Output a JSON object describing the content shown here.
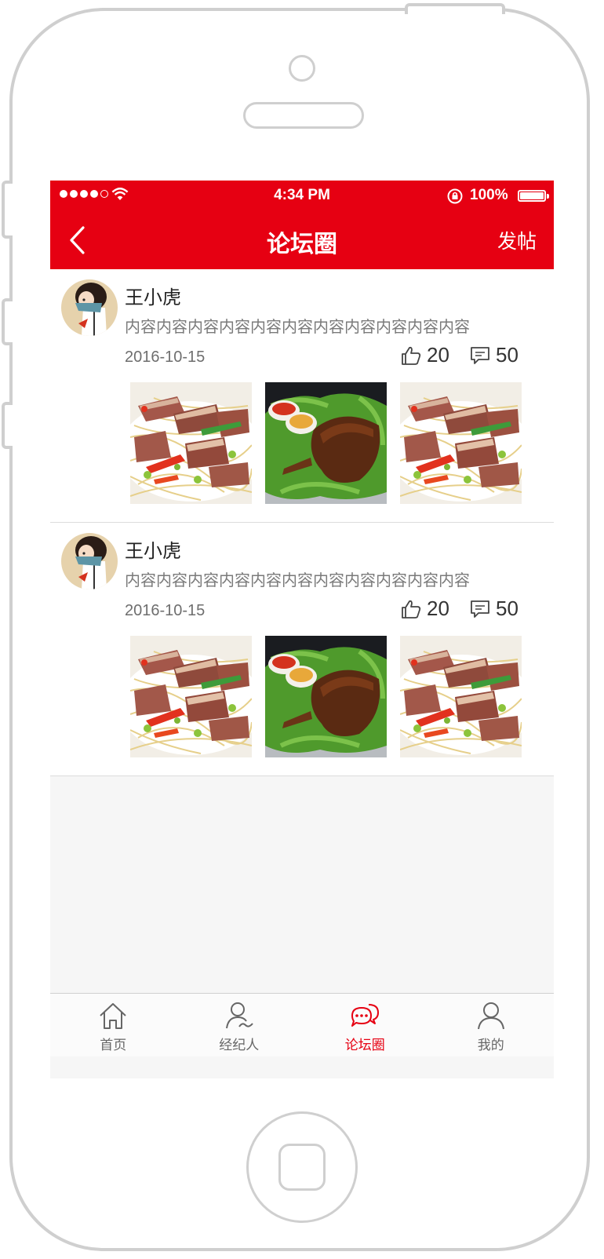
{
  "status_bar": {
    "time": "4:34 PM",
    "battery": "100%"
  },
  "nav": {
    "title": "论坛圈",
    "action": "发帖"
  },
  "posts": [
    {
      "user": "王小虎",
      "content": "内容内容内容内容内容内容内容内容内容内容内容",
      "date": "2016-10-15",
      "likes": "20",
      "comments": "50"
    },
    {
      "user": "王小虎",
      "content": "内容内容内容内容内容内容内容内容内容内容内容",
      "date": "2016-10-15",
      "likes": "20",
      "comments": "50"
    }
  ],
  "tabs": [
    {
      "label": "首页",
      "icon": "home-icon",
      "active": false
    },
    {
      "label": "经纪人",
      "icon": "agent-icon",
      "active": false
    },
    {
      "label": "论坛圈",
      "icon": "forum-icon",
      "active": true
    },
    {
      "label": "我的",
      "icon": "profile-icon",
      "active": false
    }
  ],
  "colors": {
    "brand": "#e60012",
    "background": "#f6f6f6",
    "text_secondary": "#7a7a7a"
  }
}
